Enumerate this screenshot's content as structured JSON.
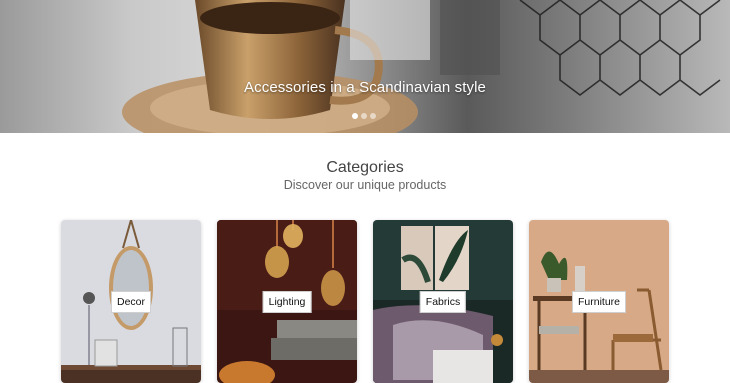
{
  "hero": {
    "caption": "Accessories in a Scandinavian style",
    "slide_count": 3,
    "active_slide": 1
  },
  "categories": {
    "title": "Categories",
    "subtitle": "Discover our unique products",
    "items": [
      {
        "label": "Decor"
      },
      {
        "label": "Lighting"
      },
      {
        "label": "Fabrics"
      },
      {
        "label": "Furniture"
      }
    ]
  }
}
